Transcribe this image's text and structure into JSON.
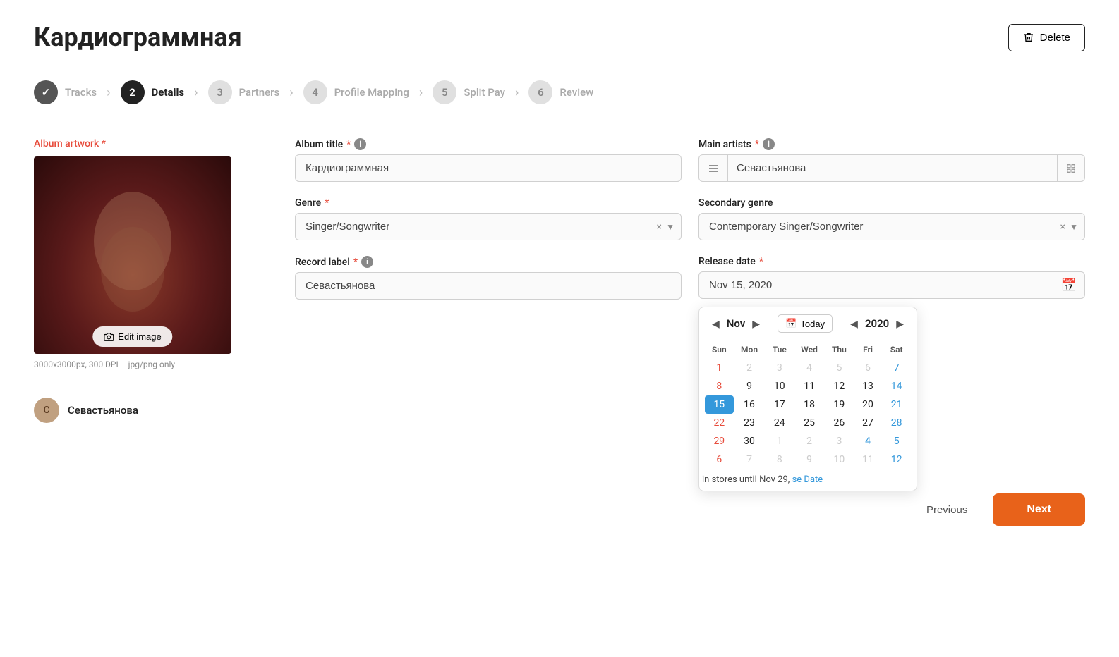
{
  "page": {
    "title": "Кардиограммная",
    "delete_label": "Delete"
  },
  "stepper": {
    "steps": [
      {
        "number": "✓",
        "label": "Tracks",
        "state": "completed"
      },
      {
        "number": "2",
        "label": "Details",
        "state": "active"
      },
      {
        "number": "3",
        "label": "Partners",
        "state": "inactive"
      },
      {
        "number": "4",
        "label": "Profile Mapping",
        "state": "inactive"
      },
      {
        "number": "5",
        "label": "Split Pay",
        "state": "inactive"
      },
      {
        "number": "6",
        "label": "Review",
        "state": "inactive"
      }
    ]
  },
  "artwork": {
    "label": "Album artwork",
    "required": "*",
    "edit_label": "Edit image",
    "info": "3000x3000px, 300 DPI – jpg/png only"
  },
  "artist": {
    "name": "Севастьянова",
    "initials": "С"
  },
  "form": {
    "album_title_label": "Album title",
    "album_title_required": "*",
    "album_title_value": "Кардиограммная",
    "genre_label": "Genre",
    "genre_required": "*",
    "genre_value": "Singer/Songwriter",
    "record_label_label": "Record label",
    "record_label_required": "*",
    "record_label_value": "Севастьянова",
    "main_artists_label": "Main artists",
    "main_artists_required": "*",
    "main_artists_value": "Севастьянова",
    "secondary_genre_label": "Secondary genre",
    "secondary_genre_value": "Contemporary Singer/Songwriter",
    "release_date_label": "Release date",
    "release_date_required": "*",
    "release_date_value": "Nov 15, 2020"
  },
  "calendar": {
    "month": "Nov",
    "year": "2020",
    "today_label": "Today",
    "days_header": [
      "Sun",
      "Mon",
      "Tue",
      "Wed",
      "Thu",
      "Fri",
      "Sat"
    ],
    "weeks": [
      [
        {
          "d": "1",
          "cls": "sunday other-month"
        },
        {
          "d": "2",
          "cls": "other-month"
        },
        {
          "d": "3",
          "cls": "other-month"
        },
        {
          "d": "4",
          "cls": "other-month"
        },
        {
          "d": "5",
          "cls": "other-month"
        },
        {
          "d": "6",
          "cls": "other-month"
        },
        {
          "d": "7",
          "cls": "saturday other-month"
        }
      ],
      [
        {
          "d": "8",
          "cls": "sunday"
        },
        {
          "d": "9",
          "cls": ""
        },
        {
          "d": "10",
          "cls": ""
        },
        {
          "d": "11",
          "cls": ""
        },
        {
          "d": "12",
          "cls": ""
        },
        {
          "d": "13",
          "cls": ""
        },
        {
          "d": "14",
          "cls": "saturday"
        }
      ],
      [
        {
          "d": "15",
          "cls": "today-selected"
        },
        {
          "d": "16",
          "cls": ""
        },
        {
          "d": "17",
          "cls": ""
        },
        {
          "d": "18",
          "cls": ""
        },
        {
          "d": "19",
          "cls": ""
        },
        {
          "d": "20",
          "cls": ""
        },
        {
          "d": "21",
          "cls": "saturday"
        }
      ],
      [
        {
          "d": "22",
          "cls": "sunday red-date"
        },
        {
          "d": "23",
          "cls": ""
        },
        {
          "d": "24",
          "cls": ""
        },
        {
          "d": "25",
          "cls": ""
        },
        {
          "d": "26",
          "cls": ""
        },
        {
          "d": "27",
          "cls": ""
        },
        {
          "d": "28",
          "cls": "saturday"
        }
      ],
      [
        {
          "d": "29",
          "cls": "sunday red-date"
        },
        {
          "d": "30",
          "cls": ""
        },
        {
          "d": "1",
          "cls": "other-month"
        },
        {
          "d": "2",
          "cls": "other-month"
        },
        {
          "d": "3",
          "cls": "other-month"
        },
        {
          "d": "4",
          "cls": "saturday other-month"
        },
        {
          "d": "5",
          "cls": "saturday other-month"
        }
      ],
      [
        {
          "d": "6",
          "cls": "sunday other-month"
        },
        {
          "d": "7",
          "cls": "other-month"
        },
        {
          "d": "8",
          "cls": "other-month"
        },
        {
          "d": "9",
          "cls": "other-month"
        },
        {
          "d": "10",
          "cls": "other-month"
        },
        {
          "d": "11",
          "cls": "other-month"
        },
        {
          "d": "12",
          "cls": "saturday other-month"
        }
      ]
    ]
  },
  "store_info": "in stores until Nov 29,",
  "store_link": "se Date",
  "buttons": {
    "previous": "Previous",
    "next": "Next"
  }
}
